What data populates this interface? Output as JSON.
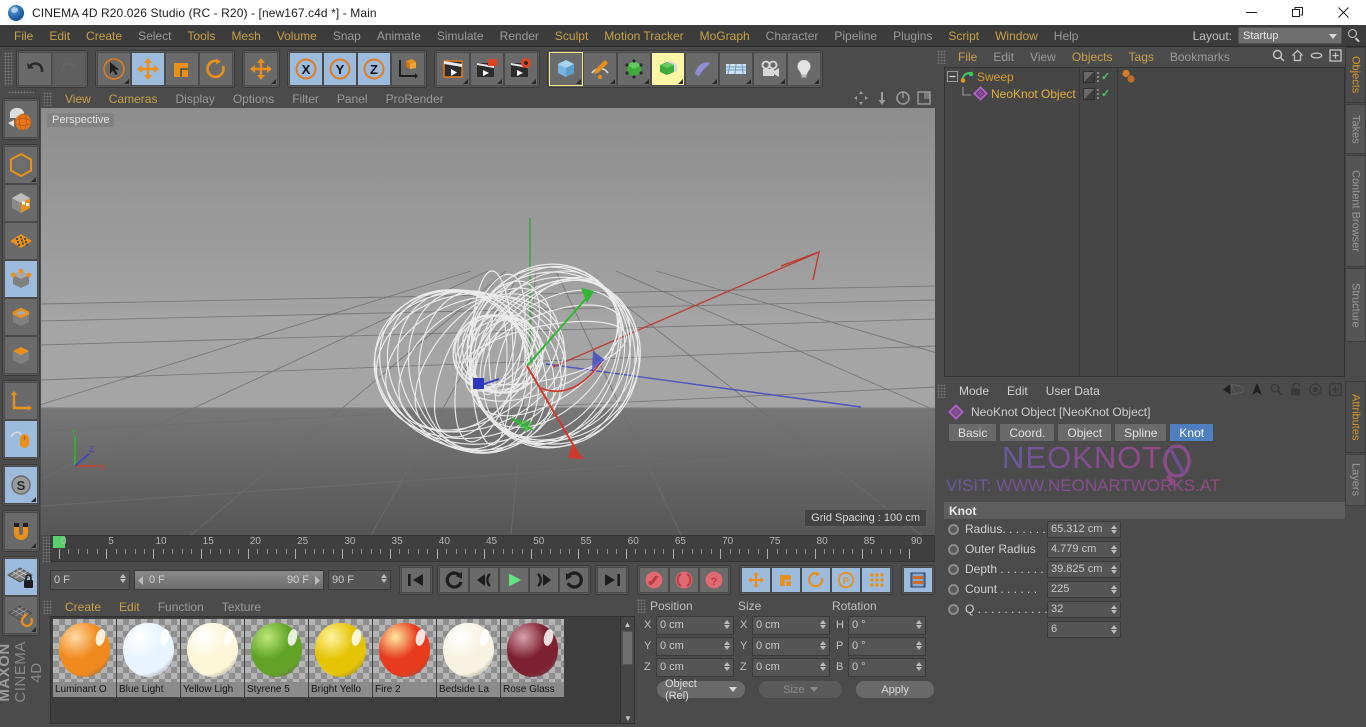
{
  "window": {
    "title": "CINEMA 4D R20.026 Studio (RC - R20) - [new167.c4d *] - Main",
    "minimize": "—",
    "maximize": "❐",
    "close": "✕"
  },
  "menubar": {
    "items": [
      {
        "label": "File",
        "dim": false
      },
      {
        "label": "Edit",
        "dim": false
      },
      {
        "label": "Create",
        "dim": false
      },
      {
        "label": "Select",
        "dim": true
      },
      {
        "label": "Tools",
        "dim": false
      },
      {
        "label": "Mesh",
        "dim": false
      },
      {
        "label": "Volume",
        "dim": false
      },
      {
        "label": "Snap",
        "dim": true
      },
      {
        "label": "Animate",
        "dim": true
      },
      {
        "label": "Simulate",
        "dim": true
      },
      {
        "label": "Render",
        "dim": true
      },
      {
        "label": "Sculpt",
        "dim": false
      },
      {
        "label": "Motion Tracker",
        "dim": false
      },
      {
        "label": "MoGraph",
        "dim": false
      },
      {
        "label": "Character",
        "dim": true
      },
      {
        "label": "Pipeline",
        "dim": true
      },
      {
        "label": "Plugins",
        "dim": true
      },
      {
        "label": "Script",
        "dim": false
      },
      {
        "label": "Window",
        "dim": false
      },
      {
        "label": "Help",
        "dim": true
      }
    ],
    "layout_label": "Layout:",
    "layout_value": "Startup"
  },
  "toolbar": {
    "buttons": [
      {
        "name": "undo-button",
        "selected": false
      },
      {
        "name": "redo-button",
        "selected": false
      },
      {
        "name": "live-selection-tool",
        "selected": false
      },
      {
        "name": "move-tool",
        "selected": true
      },
      {
        "name": "scale-tool",
        "selected": false
      },
      {
        "name": "rotate-tool",
        "selected": false
      },
      {
        "name": "move-dynamic-tool",
        "selected": false
      },
      {
        "name": "x-axis-lock",
        "selected": true
      },
      {
        "name": "y-axis-lock",
        "selected": true
      },
      {
        "name": "z-axis-lock",
        "selected": true
      },
      {
        "name": "world-object-coordinate-toggle",
        "selected": false
      },
      {
        "name": "render-view-button",
        "selected": false
      },
      {
        "name": "render-region-button",
        "selected": false
      },
      {
        "name": "render-settings-button",
        "selected": false
      },
      {
        "name": "add-cube-primitive",
        "selected": false
      },
      {
        "name": "add-spline-pen",
        "selected": false
      },
      {
        "name": "generators-menu",
        "selected": false
      },
      {
        "name": "deformers-menu",
        "selected": true
      },
      {
        "name": "mograph-menu",
        "selected": false
      },
      {
        "name": "scene-environment-menu",
        "selected": false
      },
      {
        "name": "camera-menu",
        "selected": false
      },
      {
        "name": "light-menu",
        "selected": false
      }
    ]
  },
  "lefttoolbar": {
    "buttons": [
      {
        "name": "make-editable-button"
      },
      {
        "name": "model-mode"
      },
      {
        "name": "texture-mode"
      },
      {
        "name": "points-mode"
      },
      {
        "name": "edges-mode"
      },
      {
        "name": "polygons-mode"
      },
      {
        "name": "object-axis-mode"
      },
      {
        "name": "enable-axis-modification"
      },
      {
        "name": "enable-snapping"
      },
      {
        "name": "quantize-snap"
      },
      {
        "name": "workplane-lock"
      },
      {
        "name": "workplane-rotate"
      }
    ],
    "brand_top": "MAXON",
    "brand_bottom": "CINEMA 4D"
  },
  "viewport": {
    "menus": [
      {
        "label": "View",
        "highlight": true
      },
      {
        "label": "Cameras",
        "highlight": true
      },
      {
        "label": "Display",
        "highlight": false
      },
      {
        "label": "Options",
        "highlight": false
      },
      {
        "label": "Filter",
        "highlight": false
      },
      {
        "label": "Panel",
        "highlight": false
      },
      {
        "label": "ProRender",
        "highlight": false
      }
    ],
    "view_label": "Perspective",
    "grid_spacing": "Grid Spacing : 100 cm",
    "axis_labels": {
      "y": "Y",
      "x": "X",
      "z": "Z"
    },
    "corner_icons": [
      "move-view-icon",
      "dolly-view-icon",
      "rotate-view-icon",
      "maximize-view-icon"
    ]
  },
  "timeline": {
    "ticks": [
      "0",
      "5",
      "10",
      "15",
      "20",
      "25",
      "30",
      "35",
      "40",
      "45",
      "50",
      "55",
      "60",
      "65",
      "70",
      "75",
      "80",
      "85",
      "90"
    ],
    "current_frame": "0 F",
    "preview_start": "0 F",
    "preview_end": "90 F",
    "document_end": "90 F",
    "frame_display": "0 F",
    "transport": [
      {
        "name": "go-to-start-button"
      },
      {
        "name": "play-backwards-loop-button"
      },
      {
        "name": "step-back-button"
      },
      {
        "name": "play-button"
      },
      {
        "name": "step-forward-button"
      },
      {
        "name": "loop-button"
      },
      {
        "name": "go-to-end-button"
      },
      {
        "name": "record-active-objects-button"
      },
      {
        "name": "autokeying-button"
      },
      {
        "name": "keyframe-selection-button"
      },
      {
        "name": "position-key-button"
      },
      {
        "name": "scale-key-button"
      },
      {
        "name": "rotation-key-button"
      },
      {
        "name": "parameter-key-button"
      },
      {
        "name": "point-level-animation-button"
      },
      {
        "name": "timeline-view-button"
      }
    ]
  },
  "materials": {
    "menus": [
      {
        "label": "Create",
        "dim": false
      },
      {
        "label": "Edit",
        "dim": false
      },
      {
        "label": "Function",
        "dim": true
      },
      {
        "label": "Texture",
        "dim": true
      }
    ],
    "items": [
      {
        "name": "Luminant O",
        "color": "#f08a1e",
        "highlight": "#ffd9a6"
      },
      {
        "name": "Blue Light",
        "color": "#e8f4ff",
        "highlight": "#ffffff"
      },
      {
        "name": "Yellow Ligh",
        "color": "#fdf6d8",
        "highlight": "#ffffff"
      },
      {
        "name": "Styrene 5",
        "color": "#62a327",
        "highlight": "#bde87a"
      },
      {
        "name": "Bright Yello",
        "color": "#e5c406",
        "highlight": "#fff4a0"
      },
      {
        "name": "Fire 2",
        "color": "#e83a1c",
        "highlight": "#ffe9a0"
      },
      {
        "name": "Bedside La",
        "color": "#f7f2e2",
        "highlight": "#ffffff"
      },
      {
        "name": "Rose Glass",
        "color": "#7d2130",
        "highlight": "#d9a0ad"
      }
    ]
  },
  "coordinates": {
    "headers": [
      "Position",
      "Size",
      "Rotation"
    ],
    "rows": [
      {
        "pos_axis": "X",
        "pos_value": "0 cm",
        "size_axis": "X",
        "size_value": "0 cm",
        "rot_axis": "H",
        "rot_value": "0 °"
      },
      {
        "pos_axis": "Y",
        "pos_value": "0 cm",
        "size_axis": "Y",
        "size_value": "0 cm",
        "rot_axis": "P",
        "rot_value": "0 °"
      },
      {
        "pos_axis": "Z",
        "pos_value": "0 cm",
        "size_axis": "Z",
        "size_value": "0 cm",
        "rot_axis": "B",
        "rot_value": "0 °"
      }
    ],
    "mode_dropdown": "Object (Rel)",
    "size_dropdown": "Size",
    "apply_button": "Apply"
  },
  "objects": {
    "menus": [
      {
        "label": "File",
        "dim": false
      },
      {
        "label": "Edit",
        "dim": true
      },
      {
        "label": "View",
        "dim": true
      },
      {
        "label": "Objects",
        "dim": false
      },
      {
        "label": "Tags",
        "dim": false
      },
      {
        "label": "Bookmarks",
        "dim": true
      }
    ],
    "icons": [
      "search-icon",
      "home-icon",
      "ellipse-icon",
      "add-layout-icon"
    ],
    "tree": [
      {
        "label": "Sweep",
        "icon": "sweep-icon",
        "color": "#d79a2b",
        "indent": 0,
        "expander": true
      },
      {
        "label": "NeoKnot Object",
        "icon": "neoknot-icon",
        "color": "#e6b040",
        "indent": 1,
        "expander": false
      }
    ]
  },
  "attributes": {
    "menus": [
      "Mode",
      "Edit",
      "User Data"
    ],
    "icons": [
      "back-history-icon",
      "up-arrow-icon",
      "search-icon",
      "lock-icon",
      "target-icon",
      "add-icon"
    ],
    "object_title": "NeoKnot Object [NeoKnot Object]",
    "tabs": [
      {
        "label": "Basic",
        "active": false
      },
      {
        "label": "Coord.",
        "active": false
      },
      {
        "label": "Object",
        "active": false
      },
      {
        "label": "Spline",
        "active": false
      },
      {
        "label": "Knot",
        "active": true
      }
    ],
    "watermark_big": "NEOKNOT",
    "watermark_small": "VISIT: WWW.NEONARTWORKS.AT",
    "section_title": "Knot",
    "params": [
      {
        "label": "Radius. . . . . . .",
        "value": "65.312 cm"
      },
      {
        "label": "Outer Radius",
        "value": "4.779 cm"
      },
      {
        "label": "Depth . . . . . . .",
        "value": "39.825 cm"
      },
      {
        "label": "Count . . . . . .",
        "value": "225"
      },
      {
        "label": "Q . . . . . . . . . . .",
        "value": "32"
      },
      {
        "label": "",
        "value": "6"
      }
    ]
  },
  "dock": {
    "group1": [
      {
        "label": "Objects",
        "active": true
      },
      {
        "label": "Takes",
        "active": false
      },
      {
        "label": "Content Browser",
        "active": false
      },
      {
        "label": "Structure",
        "active": false
      }
    ],
    "group2": [
      {
        "label": "Attributes",
        "active": true
      },
      {
        "label": "Layers",
        "active": false
      }
    ]
  },
  "colors": {
    "accent_yellow": "#c7a14a",
    "accent_orange": "#d79a2b",
    "selected_blue": "#9cbbdd",
    "tab_blue": "#4f7fc0",
    "panel_bg": "#4b4b4b"
  }
}
